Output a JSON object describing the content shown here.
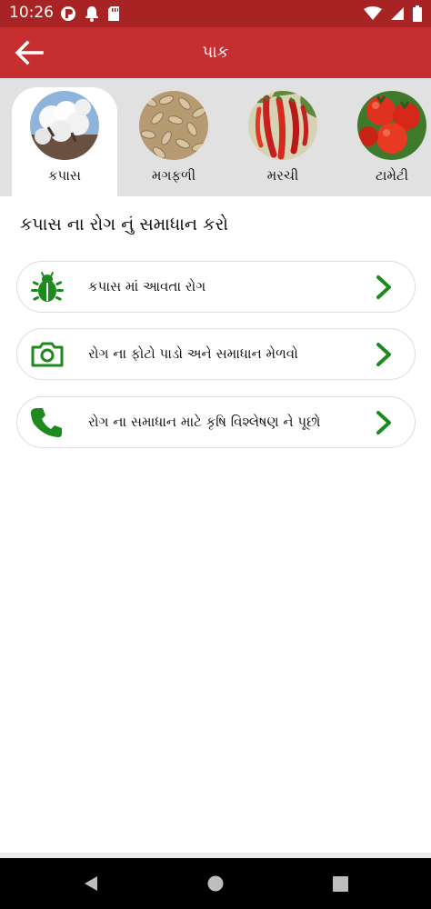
{
  "status_bar": {
    "time": "10:26",
    "left_icons": [
      "app-notification-icon",
      "bell-icon",
      "sd-card-icon"
    ],
    "right_icons": [
      "wifi-icon",
      "signal-icon",
      "battery-icon"
    ]
  },
  "app_bar": {
    "title": "પાક",
    "back_icon": "arrow-left-icon",
    "color": "#c62e30"
  },
  "crops": [
    {
      "label": "કપાસ",
      "selected": true
    },
    {
      "label": "મગફળી",
      "selected": false
    },
    {
      "label": "મરચી",
      "selected": false
    },
    {
      "label": "ટામેટી",
      "selected": false
    }
  ],
  "section": {
    "title": "કપાસ ના રોગ નું સમાધાન કરો"
  },
  "options": [
    {
      "label": "કપાસ માં આવતા રોગ",
      "icon": "bug-icon"
    },
    {
      "label": "રોગ ના ફોટો પાડો અને સમાધાન મેળવો",
      "icon": "camera-icon"
    },
    {
      "label": "રોગ ના સમાધાન માટે કૃષિ વિશ્લેષણ ને પૂછો",
      "icon": "phone-icon"
    }
  ],
  "accent_color": "#1e8a1e",
  "nav": [
    "back-icon",
    "home-icon",
    "recents-icon"
  ]
}
